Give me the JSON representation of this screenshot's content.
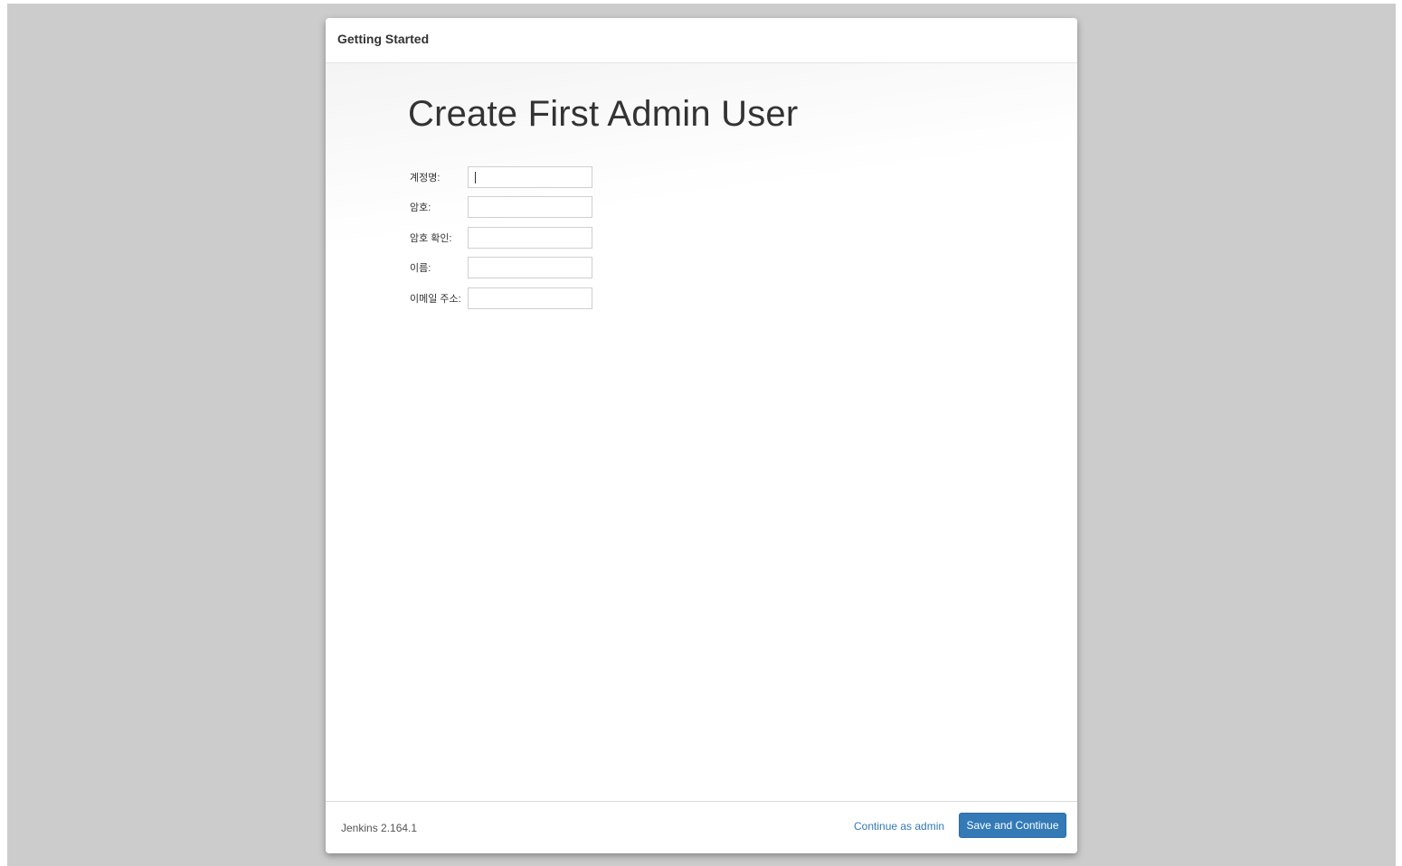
{
  "dialog": {
    "title": "Getting Started"
  },
  "main": {
    "heading": "Create First Admin User",
    "fields": [
      {
        "label": "계정명:",
        "value": "",
        "focused": true
      },
      {
        "label": "암호:",
        "value": ""
      },
      {
        "label": "암호 확인:",
        "value": ""
      },
      {
        "label": "이름:",
        "value": ""
      },
      {
        "label": "이메일 주소:",
        "value": ""
      }
    ]
  },
  "footer": {
    "version": "Jenkins 2.164.1",
    "continue_label": "Continue as admin",
    "save_label": "Save and Continue"
  },
  "colors": {
    "backdrop": "#cccccc",
    "primary_button": "#337ab7",
    "link": "#337ab7"
  }
}
